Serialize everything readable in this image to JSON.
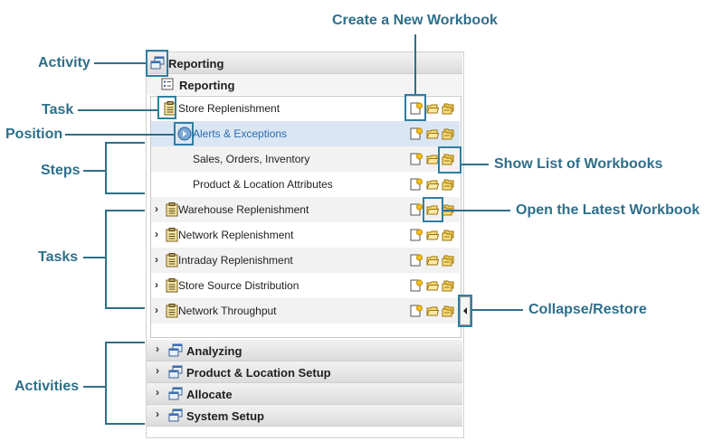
{
  "panel": {
    "activity_reporting": "Reporting",
    "task_group": "Reporting",
    "rows": [
      {
        "label": "Store Replenishment",
        "kind": "task",
        "expanded": true
      },
      {
        "label": "Alerts & Exceptions",
        "kind": "step",
        "selected": true
      },
      {
        "label": "Sales, Orders, Inventory",
        "kind": "step"
      },
      {
        "label": "Product & Location Attributes",
        "kind": "step"
      },
      {
        "label": "Warehouse Replenishment",
        "kind": "task"
      },
      {
        "label": "Network Replenishment",
        "kind": "task"
      },
      {
        "label": "Intraday Replenishment",
        "kind": "task"
      },
      {
        "label": "Store Source Distribution",
        "kind": "task"
      },
      {
        "label": "Network Throughput",
        "kind": "task"
      }
    ],
    "activities": [
      "Analyzing",
      "Product & Location Setup",
      "Allocate",
      "System Setup"
    ]
  },
  "callouts": {
    "activity": "Activity",
    "task": "Task",
    "position": "Position",
    "steps": "Steps",
    "tasks": "Tasks",
    "activities": "Activities",
    "create_new": "Create a New Workbook",
    "show_list": "Show List of Workbooks",
    "open_latest": "Open the Latest Workbook",
    "collapse_restore": "Collapse/Restore"
  },
  "icons": {
    "activity": "stacked-windows-icon",
    "task_group": "task-list-icon",
    "task": "clipboard-icon",
    "position": "arrow-circle-icon",
    "new_workbook": "new-workbook-icon",
    "open_latest": "open-folder-icon",
    "list_workbooks": "folders-list-icon",
    "expand": "chevron-right-icon",
    "collapse": "collapse-arrow-icon"
  },
  "colors": {
    "callout": "#2e6f8a",
    "highlight": "#2e7fa3",
    "selected_row": "#dbe6f4",
    "selected_text": "#2a6cb0"
  }
}
